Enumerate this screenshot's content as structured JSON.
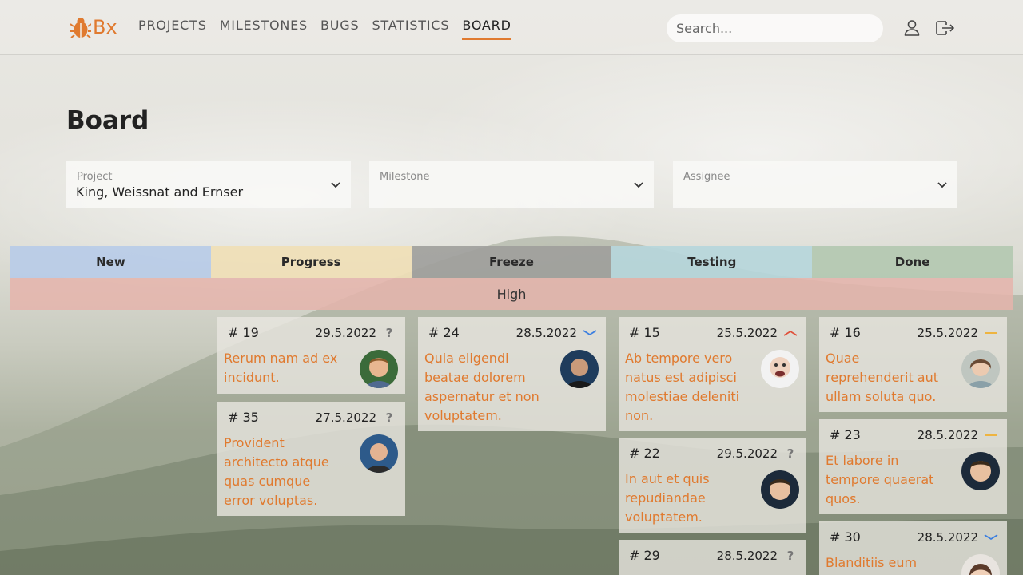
{
  "app": {
    "logo_text": "Bx"
  },
  "nav": {
    "items": [
      {
        "label": "PROJECTS"
      },
      {
        "label": "MILESTONES"
      },
      {
        "label": "BUGS"
      },
      {
        "label": "STATISTICS"
      },
      {
        "label": "BOARD"
      }
    ],
    "active": "BOARD"
  },
  "search": {
    "placeholder": "Search..."
  },
  "page": {
    "title": "Board"
  },
  "filters": {
    "project": {
      "label": "Project",
      "value": "King, Weissnat and Ernser"
    },
    "milestone": {
      "label": "Milestone",
      "value": ""
    },
    "assignee": {
      "label": "Assignee",
      "value": ""
    }
  },
  "board": {
    "columns": [
      {
        "name": "New",
        "color": "#b7cbe8"
      },
      {
        "name": "Progress",
        "color": "#f0dfb6"
      },
      {
        "name": "Freeze",
        "color": "#9e9e9b"
      },
      {
        "name": "Testing",
        "color": "#b6d6dc"
      },
      {
        "name": "Done",
        "color": "#b3c8b0"
      }
    ],
    "priority_group": "High",
    "cards": [
      {
        "number": "# 19",
        "date": "29.5.2022",
        "priority_icon": "unknown",
        "title": "Rerum nam ad ex incidunt."
      },
      {
        "number": "# 35",
        "date": "27.5.2022",
        "priority_icon": "unknown",
        "title": "Provident architecto atque quas cumque error voluptas."
      },
      {
        "number": "# 24",
        "date": "28.5.2022",
        "priority_icon": "low",
        "title": "Quia eligendi beatae dolorem aspernatur et non voluptatem."
      },
      {
        "number": "# 15",
        "date": "25.5.2022",
        "priority_icon": "high",
        "title": "Ab tempore vero natus est adipisci molestiae deleniti non."
      },
      {
        "number": "# 22",
        "date": "29.5.2022",
        "priority_icon": "unknown",
        "title": "In aut et quis repudiandae voluptatem."
      },
      {
        "number": "# 29",
        "date": "28.5.2022",
        "priority_icon": "unknown",
        "title": ""
      },
      {
        "number": "# 16",
        "date": "25.5.2022",
        "priority_icon": "medium",
        "title": "Quae reprehenderit aut ullam soluta quo."
      },
      {
        "number": "# 23",
        "date": "28.5.2022",
        "priority_icon": "medium",
        "title": "Et labore in tempore quaerat quos."
      },
      {
        "number": "# 30",
        "date": "28.5.2022",
        "priority_icon": "low",
        "title": "Blanditiis eum"
      }
    ],
    "priority_colors": {
      "high": "#e0503a",
      "medium": "#f0b030",
      "low": "#3a7ee0",
      "unknown": "#777777"
    }
  }
}
